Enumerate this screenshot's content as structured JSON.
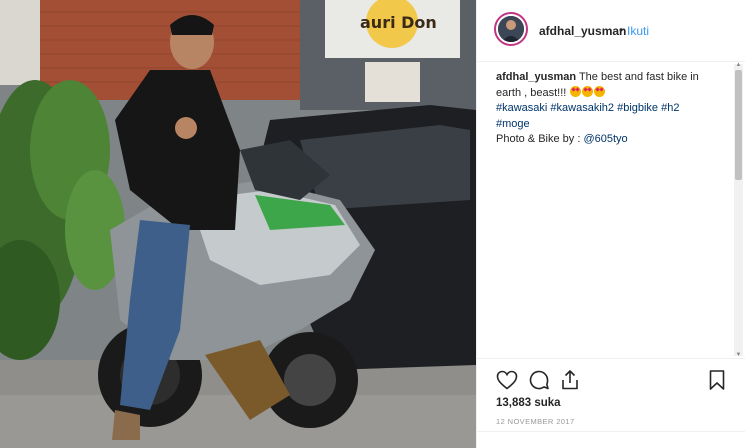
{
  "photo": {
    "alt": "",
    "sign_text": "auri Don"
  },
  "post": {
    "username": "afdhal_yusman",
    "separator": "•",
    "follow_label": "Ikuti",
    "caption": {
      "user": "afdhal_yusman",
      "text": "The best and fast bike in earth , beast!!!",
      "hashtags": [
        "#kawasaki",
        "#kawasakih2",
        "#bigbike",
        "#h2",
        "#moge"
      ],
      "credit_text": "Photo & Bike by : ",
      "credit_mention": "@605tyo"
    },
    "likes_label": "13,883 suka",
    "date_label": "12 NOVEMBER 2017"
  },
  "icons": {
    "like": "heart-icon",
    "comment": "comment-icon",
    "share": "share-icon",
    "save": "bookmark-icon"
  },
  "colors": {
    "accent": "#3897f0",
    "hashtag": "#003569",
    "text": "#262626",
    "muted": "#999999"
  }
}
